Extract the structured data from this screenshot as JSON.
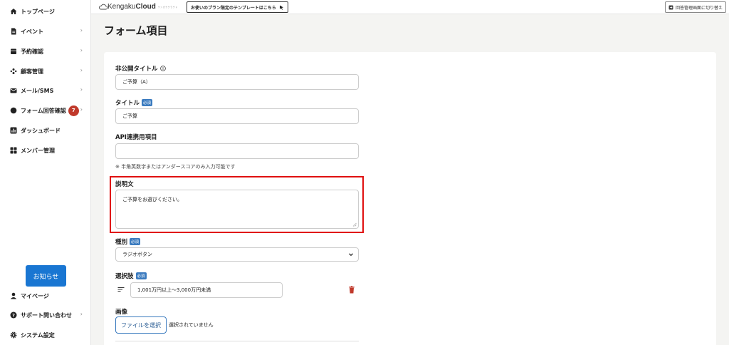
{
  "sidebar": {
    "items": [
      {
        "label": "トップページ",
        "icon": "home-icon",
        "chevron": ""
      },
      {
        "label": "イベント",
        "icon": "document-icon",
        "chevron": "›"
      },
      {
        "label": "予約確認",
        "icon": "calendar-icon",
        "chevron": "›"
      },
      {
        "label": "顧客管理",
        "icon": "customers-icon",
        "chevron": "›"
      },
      {
        "label": "メール/SMS",
        "icon": "mail-icon",
        "chevron": "›"
      },
      {
        "label": "フォーム回答確認",
        "icon": "chat-icon",
        "chevron": "›",
        "badge": "7"
      },
      {
        "label": "ダッシュボード",
        "icon": "chart-icon",
        "chevron": ""
      },
      {
        "label": "メンバー管理",
        "icon": "grid-icon",
        "chevron": ""
      }
    ],
    "notice_label": "お知らせ",
    "bottom_items": [
      {
        "label": "マイページ",
        "icon": "user-icon",
        "chevron": ""
      },
      {
        "label": "サポート問い合わせ",
        "icon": "help-icon",
        "chevron": "›"
      },
      {
        "label": "システム設定",
        "icon": "gear-icon",
        "chevron": ""
      }
    ]
  },
  "topbar": {
    "brand_light": "Kengaku",
    "brand_bold": "Cloud",
    "brand_tag": "ケンガククラウド",
    "template_label": "お使いのプラン限定のテンプレートはこちら",
    "switch_label": "回答管理画面に切り替え"
  },
  "page_title": "フォーム項目",
  "form": {
    "private_title_label": "非公開タイトル",
    "private_title_value": "ご予算（A）",
    "title_label": "タイトル",
    "required_badge": "必須",
    "title_value": "ご予算",
    "api_label": "API連携用項目",
    "api_value": "",
    "api_help": "※ 半角英数字またはアンダースコアのみ入力可能です",
    "description_label": "説明文",
    "description_value": "ご予算をお選びください。",
    "type_label": "種別",
    "type_value": "ラジオボタン",
    "choices_label": "選択肢",
    "choice_value": "1,001万円以上～3,000万円未満",
    "image_label": "画像",
    "file_button": "ファイルを選択",
    "file_status": "選択されていません"
  },
  "colors": {
    "accent": "#1976d2",
    "required": "#3b7bbf",
    "badge": "#c0392b",
    "highlight": "#e01010",
    "trash": "#c0392b"
  }
}
